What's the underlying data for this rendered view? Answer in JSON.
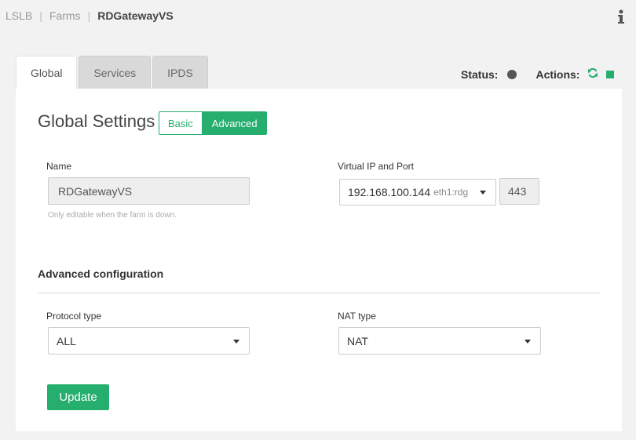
{
  "breadcrumb": {
    "items": [
      "LSLB",
      "Farms"
    ],
    "separator": "|",
    "current": "RDGatewayVS"
  },
  "tabs": [
    {
      "label": "Global",
      "active": true
    },
    {
      "label": "Services",
      "active": false
    },
    {
      "label": "IPDS",
      "active": false
    }
  ],
  "status": {
    "label": "Status:",
    "state_color": "#555555"
  },
  "actions": {
    "label": "Actions:",
    "icons": [
      "refresh-icon",
      "stop-icon"
    ],
    "icon_color": "#26ae6e"
  },
  "global_settings": {
    "title": "Global Settings",
    "mode_toggle": {
      "basic": "Basic",
      "advanced": "Advanced",
      "selected": "Advanced"
    }
  },
  "name_field": {
    "label": "Name",
    "value": "RDGatewayVS",
    "hint": "Only editable when the farm is down."
  },
  "vip_field": {
    "label": "Virtual IP and Port",
    "ip": "192.168.100.144",
    "interface": "eth1:rdg",
    "port": "443"
  },
  "advanced": {
    "title": "Advanced configuration",
    "protocol": {
      "label": "Protocol type",
      "value": "ALL"
    },
    "nat": {
      "label": "NAT type",
      "value": "NAT"
    }
  },
  "update_button": "Update",
  "colors": {
    "accent": "#26ae6e",
    "background": "#f2f2f2"
  }
}
